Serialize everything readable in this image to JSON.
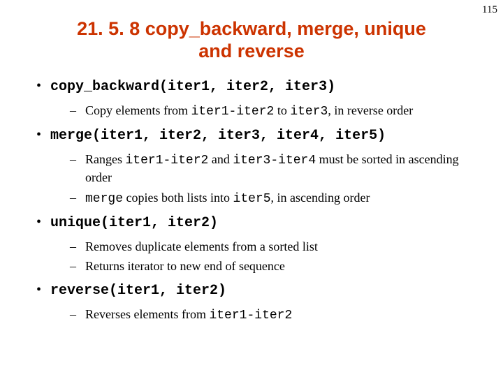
{
  "page_number": "115",
  "title": "21. 5. 8 copy_backward, merge, unique and reverse",
  "items": [
    {
      "heading": "copy_backward(iter1, iter2, iter3)",
      "sub": [
        {
          "pre": "Copy elements from ",
          "code1": "iter1-iter2",
          "mid": " to ",
          "code2": "iter3",
          "post": ", in reverse order"
        }
      ]
    },
    {
      "heading": "merge(iter1, iter2, iter3, iter4, iter5)",
      "sub": [
        {
          "pre": "Ranges ",
          "code1": "iter1-iter2",
          "mid": " and ",
          "code2": "iter3-iter4",
          "post": " must be sorted in ascending order"
        },
        {
          "code1": "merge",
          "mid": " copies both lists into ",
          "code2": "iter5",
          "post": ", in ascending order"
        }
      ]
    },
    {
      "heading": "unique(iter1, iter2)",
      "sub": [
        {
          "pre": "Removes duplicate elements from a sorted list"
        },
        {
          "pre": "Returns iterator to new end of sequence"
        }
      ]
    },
    {
      "heading": "reverse(iter1, iter2)",
      "sub": [
        {
          "pre": "Reverses elements from ",
          "code1": "iter1-iter2"
        }
      ]
    }
  ]
}
